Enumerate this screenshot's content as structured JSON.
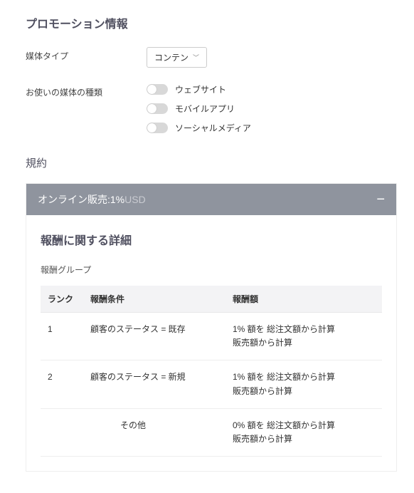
{
  "promo": {
    "title": "プロモーション情報",
    "mediaTypeLabel": "媒体タイプ",
    "mediaTypeValue": "コンテン",
    "mediaKindLabel": "お使いの媒体の種類",
    "toggles": [
      {
        "label": "ウェブサイト"
      },
      {
        "label": "モバイルアプリ"
      },
      {
        "label": "ソーシャルメディア"
      }
    ]
  },
  "terms": {
    "title": "規約",
    "accordion": {
      "prefix": "オンライン販売:",
      "rate": "1%",
      "currency": "USD"
    },
    "detailTitle": "報酬に関する詳細",
    "groupLabel": "報酬グループ",
    "columns": {
      "rank": "ランク",
      "condition": "報酬条件",
      "amount": "報酬額"
    },
    "rows": [
      {
        "rank": "1",
        "condition": "顧客のステータス = 既存",
        "amount": "1% 額を 総注文額から計算\n販売額から計算"
      },
      {
        "rank": "2",
        "condition": "顧客のステータス = 新規",
        "amount": "1% 額を 総注文額から計算\n販売額から計算"
      }
    ],
    "otherRow": {
      "condition": "その他",
      "amount": "0% 額を 総注文額から計算\n販売額から計算"
    }
  }
}
